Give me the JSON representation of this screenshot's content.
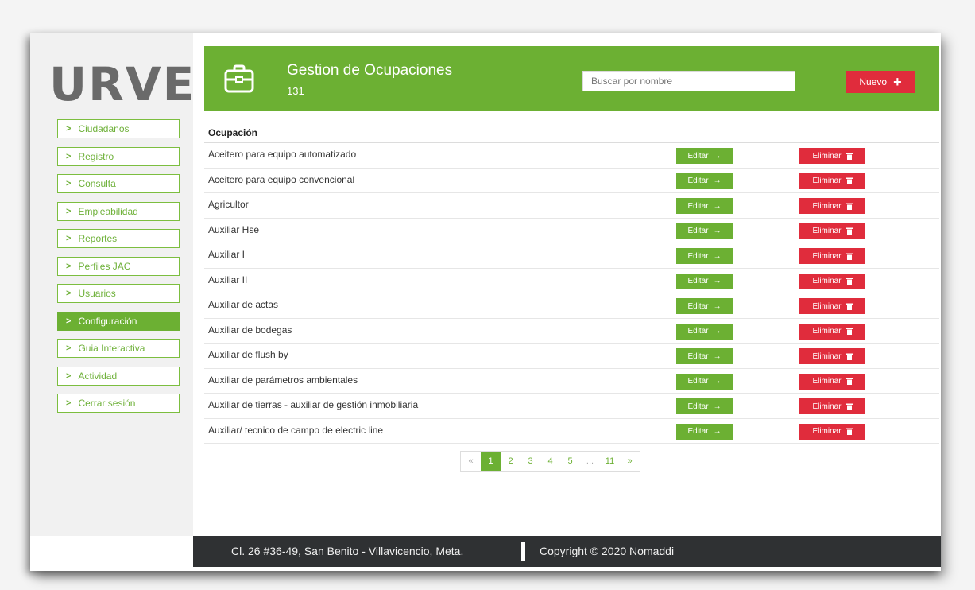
{
  "brand": {
    "logo_text": "URVE"
  },
  "sidebar": {
    "items": [
      {
        "label": "Ciudadanos"
      },
      {
        "label": "Registro"
      },
      {
        "label": "Consulta"
      },
      {
        "label": "Empleabilidad"
      },
      {
        "label": "Reportes"
      },
      {
        "label": "Perfiles JAC"
      },
      {
        "label": "Usuarios"
      },
      {
        "label": "Configuración",
        "active": true
      },
      {
        "label": "Guia Interactiva"
      },
      {
        "label": "Actividad"
      },
      {
        "label": "Cerrar sesión"
      }
    ]
  },
  "header": {
    "title": "Gestion de Ocupaciones",
    "count": "131",
    "icon": "briefcase-icon",
    "search_placeholder": "Buscar por nombre",
    "new_label": "Nuevo",
    "new_icon": "plus-icon"
  },
  "table": {
    "column": "Ocupación",
    "edit_label": "Editar",
    "delete_label": "Eliminar",
    "rows": [
      "Aceitero para equipo automatizado",
      "Aceitero para equipo convencional",
      "Agricultor",
      "Auxiliar Hse",
      "Auxiliar I",
      "Auxiliar II",
      "Auxiliar de actas",
      "Auxiliar de bodegas",
      "Auxiliar de flush by",
      "Auxiliar de parámetros ambientales",
      "Auxiliar de tierras - auxiliar de gestión inmobiliaria",
      "Auxiliar/ tecnico de campo de electric line"
    ]
  },
  "pagination": {
    "prev": "«",
    "pages": [
      "1",
      "2",
      "3",
      "4",
      "5",
      "...",
      "11"
    ],
    "next": "»",
    "current": "1"
  },
  "footer": {
    "address": "Cl. 26 #36-49, San Benito - Villavicencio, Meta.",
    "copyright": "Copyright © 2020 Nomaddi"
  },
  "colors": {
    "primary_green": "#6cb033",
    "danger_red": "#e02c3c",
    "footer_dark": "#2f3133"
  }
}
